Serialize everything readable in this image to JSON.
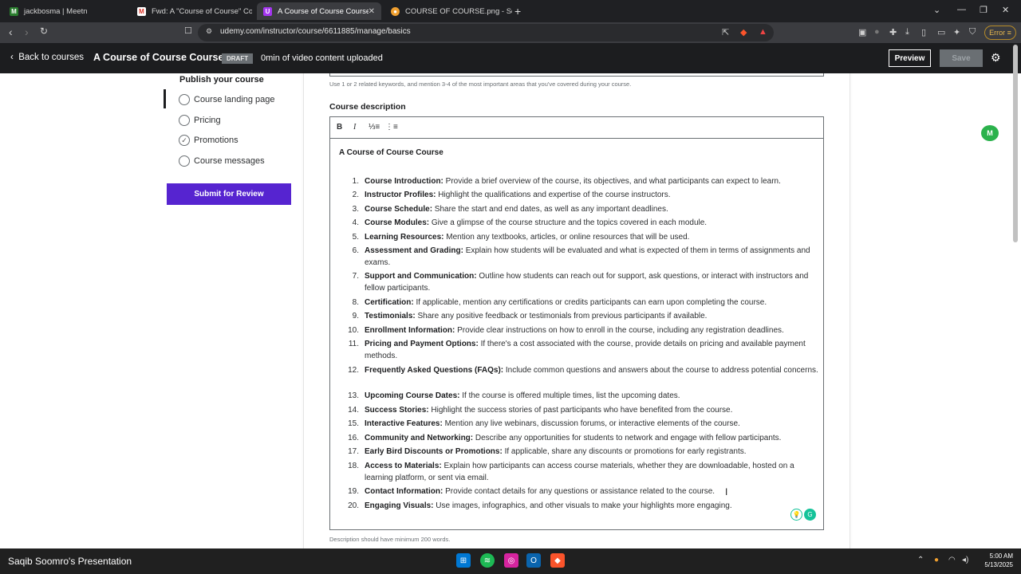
{
  "browser": {
    "tabs": [
      {
        "title": "jackbosma | Meetn",
        "icon": "meetn-icon"
      },
      {
        "title": "Fwd: A \"Course of Course\" Course -",
        "icon": "gmail-icon"
      },
      {
        "title": "A Course of Course Course Co",
        "icon": "udemy-icon",
        "active": true
      },
      {
        "title": "COURSE OF COURSE.png - Squoosh",
        "icon": "squoosh-icon"
      }
    ],
    "url": "udemy.com/instructor/course/6611885/manage/basics",
    "error_label": "Error"
  },
  "header": {
    "back_label": "Back to courses",
    "course_title": "A Course of Course Course",
    "status_badge": "DRAFT",
    "upload_status": "0min of video content uploaded",
    "preview_label": "Preview",
    "save_label": "Save"
  },
  "sidebar": {
    "section_title": "Publish your course",
    "items": [
      {
        "label": "Course landing page",
        "checked": false
      },
      {
        "label": "Pricing",
        "checked": false
      },
      {
        "label": "Promotions",
        "checked": true
      },
      {
        "label": "Course messages",
        "checked": false
      }
    ],
    "submit_label": "Submit for Review"
  },
  "main": {
    "keywords_hint": "Use 1 or 2 related keywords, and mention 3-4 of the most important areas that you've covered during your course.",
    "description_label": "Course description",
    "editor_title": "A Course of Course Course",
    "items": [
      {
        "n": "1.",
        "title": "Course Introduction:",
        "text": " Provide a brief overview of the course, its objectives, and what participants can expect to learn."
      },
      {
        "n": "2.",
        "title": "Instructor Profiles:",
        "text": " Highlight the qualifications and expertise of the course instructors."
      },
      {
        "n": "3.",
        "title": "Course Schedule:",
        "text": " Share the start and end dates, as well as any important deadlines."
      },
      {
        "n": "4.",
        "title": "Course Modules:",
        "text": " Give a glimpse of the course structure and the topics covered in each module."
      },
      {
        "n": "5.",
        "title": "Learning Resources:",
        "text": " Mention any textbooks, articles, or online resources that will be used."
      },
      {
        "n": "6.",
        "title": "Assessment and Grading:",
        "text": " Explain how students will be evaluated and what is expected of them in terms of assignments and exams."
      },
      {
        "n": "7.",
        "title": "Support and Communication:",
        "text": " Outline how students can reach out for support, ask questions, or interact with instructors and fellow participants."
      },
      {
        "n": "8.",
        "title": "Certification:",
        "text": " If applicable, mention any certifications or credits participants can earn upon completing the course."
      },
      {
        "n": "9.",
        "title": "Testimonials:",
        "text": " Share any positive feedback or testimonials from previous participants if available."
      },
      {
        "n": "10.",
        "title": "Enrollment Information:",
        "text": " Provide clear instructions on how to enroll in the course, including any registration deadlines."
      },
      {
        "n": "11.",
        "title": "Pricing and Payment Options:",
        "text": " If there's a cost associated with the course, provide details on pricing and available payment methods."
      },
      {
        "n": "12.",
        "title": "Frequently Asked Questions (FAQs):",
        "text": " Include common questions and answers about the course to address potential concerns."
      },
      {
        "n": "13.",
        "title": "Upcoming Course Dates:",
        "text": " If the course is offered multiple times, list the upcoming dates."
      },
      {
        "n": "14.",
        "title": "Success Stories:",
        "text": " Highlight the success stories of past participants who have benefited from the course."
      },
      {
        "n": "15.",
        "title": "Interactive Features:",
        "text": " Mention any live webinars, discussion forums, or interactive elements of the course."
      },
      {
        "n": "16.",
        "title": "Community and Networking:",
        "text": " Describe any opportunities for students to network and engage with fellow participants."
      },
      {
        "n": "17.",
        "title": "Early Bird Discounts or Promotions:",
        "text": " If applicable, share any discounts or promotions for early registrants."
      },
      {
        "n": "18.",
        "title": "Access to Materials:",
        "text": " Explain how participants can access course materials, whether they are downloadable, hosted on a learning platform, or sent via email."
      },
      {
        "n": "19.",
        "title": "Contact Information:",
        "text": " Provide contact details for any questions or assistance related to the course."
      },
      {
        "n": "20.",
        "title": "Engaging Visuals:",
        "text": " Use images, infographics, and other visuals to make your highlights more engaging."
      }
    ],
    "description_hint": "Description should have minimum 200 words."
  },
  "taskbar": {
    "presenter_label": "Saqib Soomro's Presentation",
    "time": "5:00 AM",
    "date": "5/13/2025"
  },
  "colors": {
    "udemy_purple": "#5624d0",
    "header_dark": "#1c1d1f",
    "grammarly_green": "#15c39a"
  }
}
